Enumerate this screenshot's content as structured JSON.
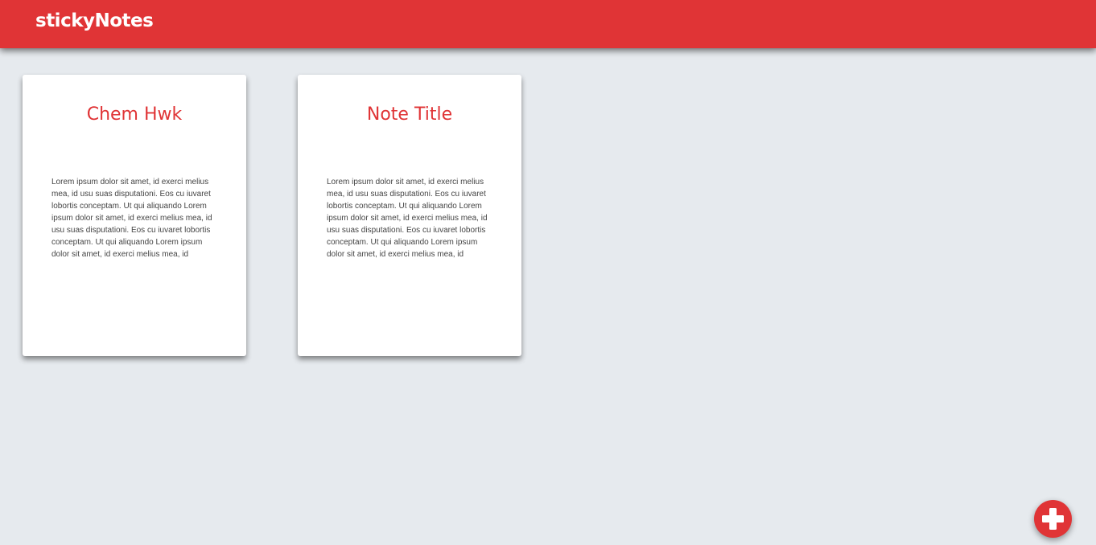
{
  "header": {
    "title": "stickyNotes"
  },
  "notes": [
    {
      "title": "Chem Hwk",
      "body": "Lorem ipsum dolor sit amet, id exerci melius mea, id usu suas disputationi. Eos cu iuvaret lobortis conceptam. Ut qui aliquando Lorem ipsum dolor sit amet, id exerci melius mea, id usu suas disputationi. Eos cu iuvaret lobortis conceptam. Ut qui aliquando Lorem ipsum dolor sit amet, id exerci melius mea, id"
    },
    {
      "title": "Note Title",
      "body": "Lorem ipsum dolor sit amet, id exerci melius mea, id usu suas disputationi. Eos cu iuvaret lobortis conceptam. Ut qui aliquando Lorem ipsum dolor sit amet, id exerci melius mea, id usu suas disputationi. Eos cu iuvaret lobortis conceptam. Ut qui aliquando Lorem ipsum dolor sit amet, id exerci melius mea, id"
    }
  ],
  "add_button": {
    "icon": "plus-icon"
  },
  "colors": {
    "accent": "#e03436",
    "background": "#e6eaee",
    "card": "#ffffff",
    "body_text": "#444444"
  }
}
